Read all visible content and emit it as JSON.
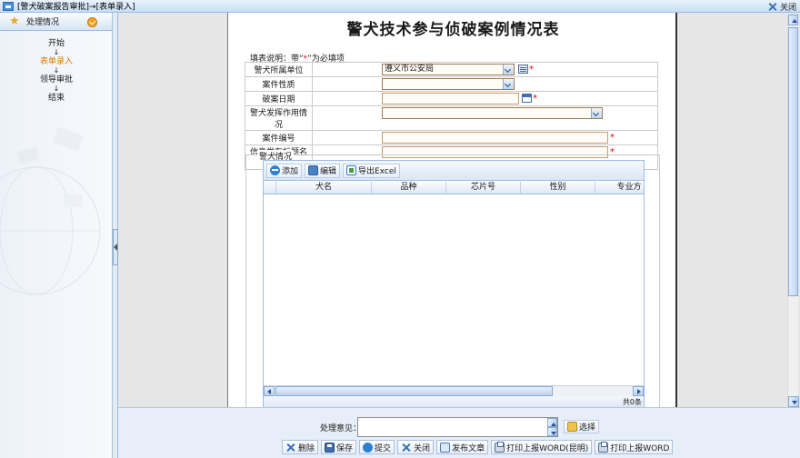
{
  "window": {
    "title": "[警犬破案报告审批]→[表单录入]",
    "close_label": "关闭"
  },
  "sidebar": {
    "header": "处理情况",
    "steps": [
      {
        "label": "开始",
        "active": false
      },
      {
        "label": "表单录入",
        "active": true
      },
      {
        "label": "领导审批",
        "active": false
      },
      {
        "label": "结束",
        "active": false
      }
    ],
    "arrow": "↓"
  },
  "form": {
    "title": "警犬技术参与侦破案例情况表",
    "note_prefix": "填表说明：带“",
    "note_star": "*",
    "note_suffix": "”为必填项",
    "required_mark": "*",
    "fields": [
      {
        "label": "警犬所属单位",
        "value": "遵义市公安局",
        "type": "select"
      },
      {
        "label": "案件性质",
        "value": "",
        "type": "select"
      },
      {
        "label": "破案日期",
        "value": "",
        "type": "date"
      },
      {
        "label": "警犬发挥作用情况",
        "value": "",
        "type": "select"
      },
      {
        "label": "案件编号",
        "value": "",
        "type": "text"
      },
      {
        "label": "信息发布标题名称",
        "value": "",
        "type": "text"
      }
    ]
  },
  "dogs": {
    "legend": "警犬情况",
    "toolbar": {
      "add": "添加",
      "edit": "编辑",
      "export": "导出Excel"
    },
    "columns": [
      "",
      "犬名",
      "品种",
      "芯片号",
      "性别",
      "专业方"
    ],
    "footer": "共0条"
  },
  "bottom": {
    "opinion_label": "处理意见：",
    "opinion_value": "",
    "choose_label": "选择",
    "buttons": {
      "delete": "删除",
      "save": "保存",
      "submit": "提交",
      "close": "关闭",
      "publish": "发布文章",
      "print_kunming": "打印上报WORD(昆明)",
      "print": "打印上报WORD"
    }
  },
  "colors": {
    "accent": "#99bbe8",
    "required": "#dd0000",
    "active_step": "#e07b00"
  }
}
